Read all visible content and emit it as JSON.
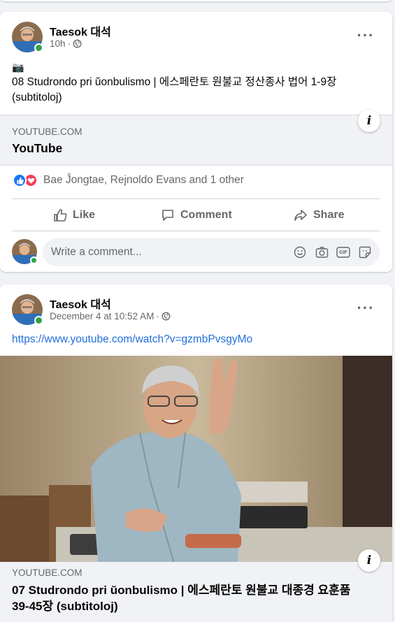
{
  "post1": {
    "author": "Taesok 대석",
    "time": "10h",
    "dot": "·",
    "camera_emoji": "📷",
    "text": "08 Studrondo pri ŭonbulismo | 에스페란토 원불교 정산종사 법어 1-9장 (subtitoloj)",
    "link": {
      "domain": "YOUTUBE.COM",
      "title": "YouTube"
    },
    "reactions": {
      "names": "Bae Ĵongtae, Rejnoldo Evans and 1 other"
    },
    "actions": {
      "like": "Like",
      "comment": "Comment",
      "share": "Share"
    },
    "comment_placeholder": "Write a comment...",
    "gif_label": "GIF"
  },
  "post2": {
    "author": "Taesok 대석",
    "time": "December 4 at 10:52 AM",
    "dot": "·",
    "url": "https://www.youtube.com/watch?v=gzmbPvsgyMo",
    "link": {
      "domain": "YOUTUBE.COM",
      "title": "07 Studrondo pri ŭonbulismo | 에스페란토 원불교 대종경 요훈품 39-45장 (subtitoloj)"
    }
  },
  "icons": {
    "more": "more-horizontal-icon",
    "globe": "globe-icon",
    "info": "info-icon",
    "like_reaction": "like-reaction-icon",
    "love_reaction": "love-reaction-icon"
  },
  "colors": {
    "link_blue": "#216fdb",
    "online_green": "#31a24c",
    "like_blue": "#1877f2",
    "love_red": "#f33e58",
    "secondary_text": "#65676b"
  }
}
